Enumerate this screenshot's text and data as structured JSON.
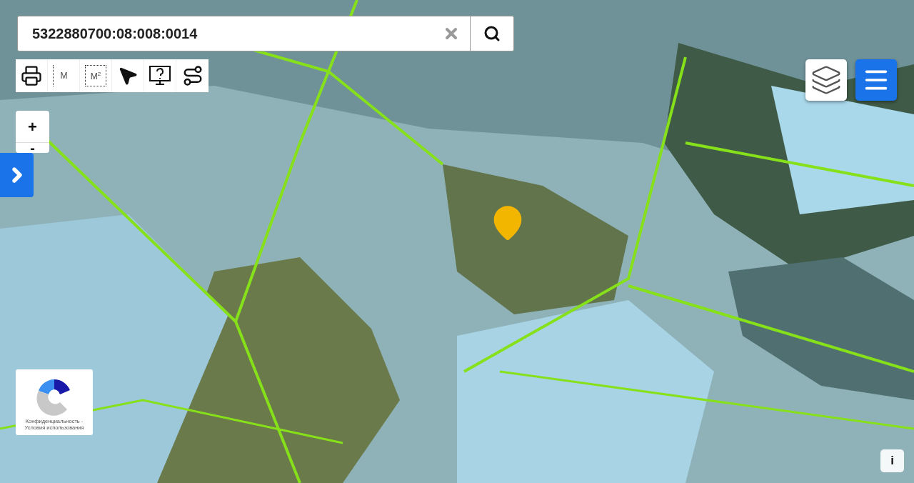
{
  "search": {
    "value": "5322880700:08:008:0014"
  },
  "toolbar": [
    {
      "kind": "print"
    },
    {
      "kind": "distance",
      "label": "M"
    },
    {
      "kind": "area",
      "label": "M$^{2}$"
    },
    {
      "kind": "pointer"
    },
    {
      "kind": "help"
    },
    {
      "kind": "route"
    }
  ],
  "zoom": {
    "in": "+",
    "out": "-"
  },
  "recaptcha": {
    "privacy": "Конфиденциальность -",
    "terms": "Условия использования"
  },
  "info": "i"
}
